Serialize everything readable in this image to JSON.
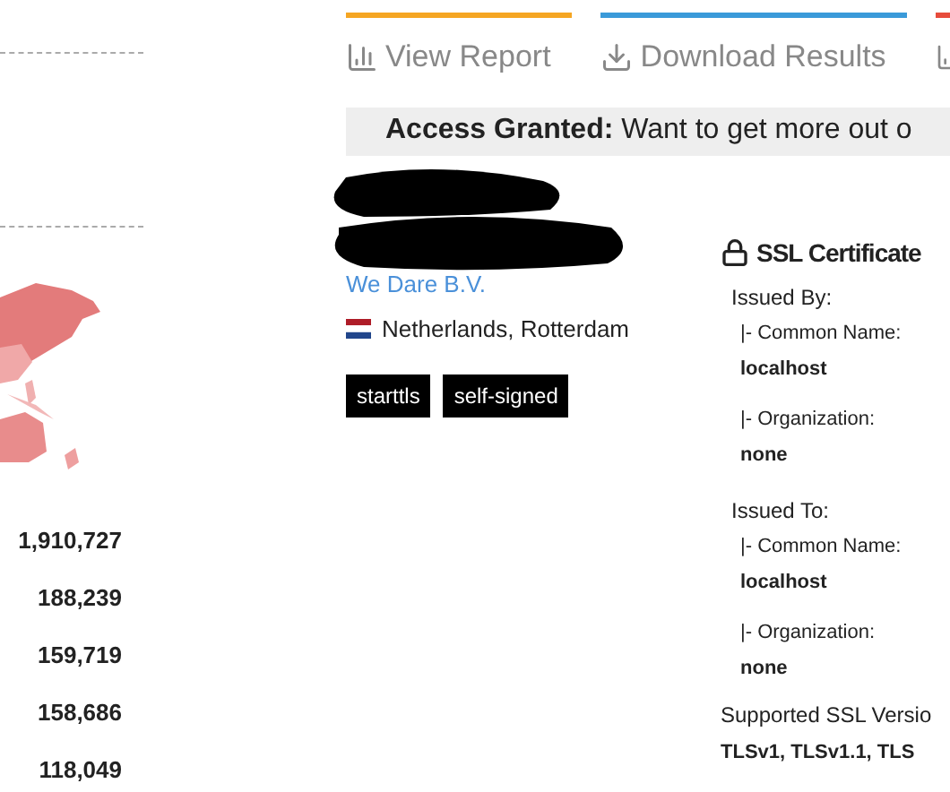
{
  "left_panel": {
    "counts": [
      "1,910,727",
      "188,239",
      "159,719",
      "158,686",
      "118,049"
    ]
  },
  "tabs": [
    {
      "label": "View Report",
      "kind": "report",
      "color": "#f5a623"
    },
    {
      "label": "Download Results",
      "kind": "download",
      "color": "#3a9ad9"
    },
    {
      "kind": "chart",
      "color": "#e74c3c"
    }
  ],
  "banner": {
    "text": "**Access Granted:** Want to get more out o"
  },
  "host": {
    "organization": "We Dare B.V.",
    "location": "Netherlands, Rotterdam",
    "tags": [
      "starttls",
      "self-signed"
    ]
  },
  "ssl": {
    "title": "SSL Certificate",
    "sections": [
      {
        "heading": "Issued By:",
        "fields": [
          {
            "label": "|- Common Name:",
            "value": "localhost"
          },
          {
            "label": "|- Organization:",
            "value": "none"
          }
        ]
      },
      {
        "heading": "Issued To:",
        "fields": [
          {
            "label": "|- Common Name:",
            "value": "localhost"
          },
          {
            "label": "|- Organization:",
            "value": "none"
          }
        ]
      }
    ],
    "versions_label": "Supported SSL Versio",
    "versions": "TLSv1, TLSv1.1, TLS"
  }
}
